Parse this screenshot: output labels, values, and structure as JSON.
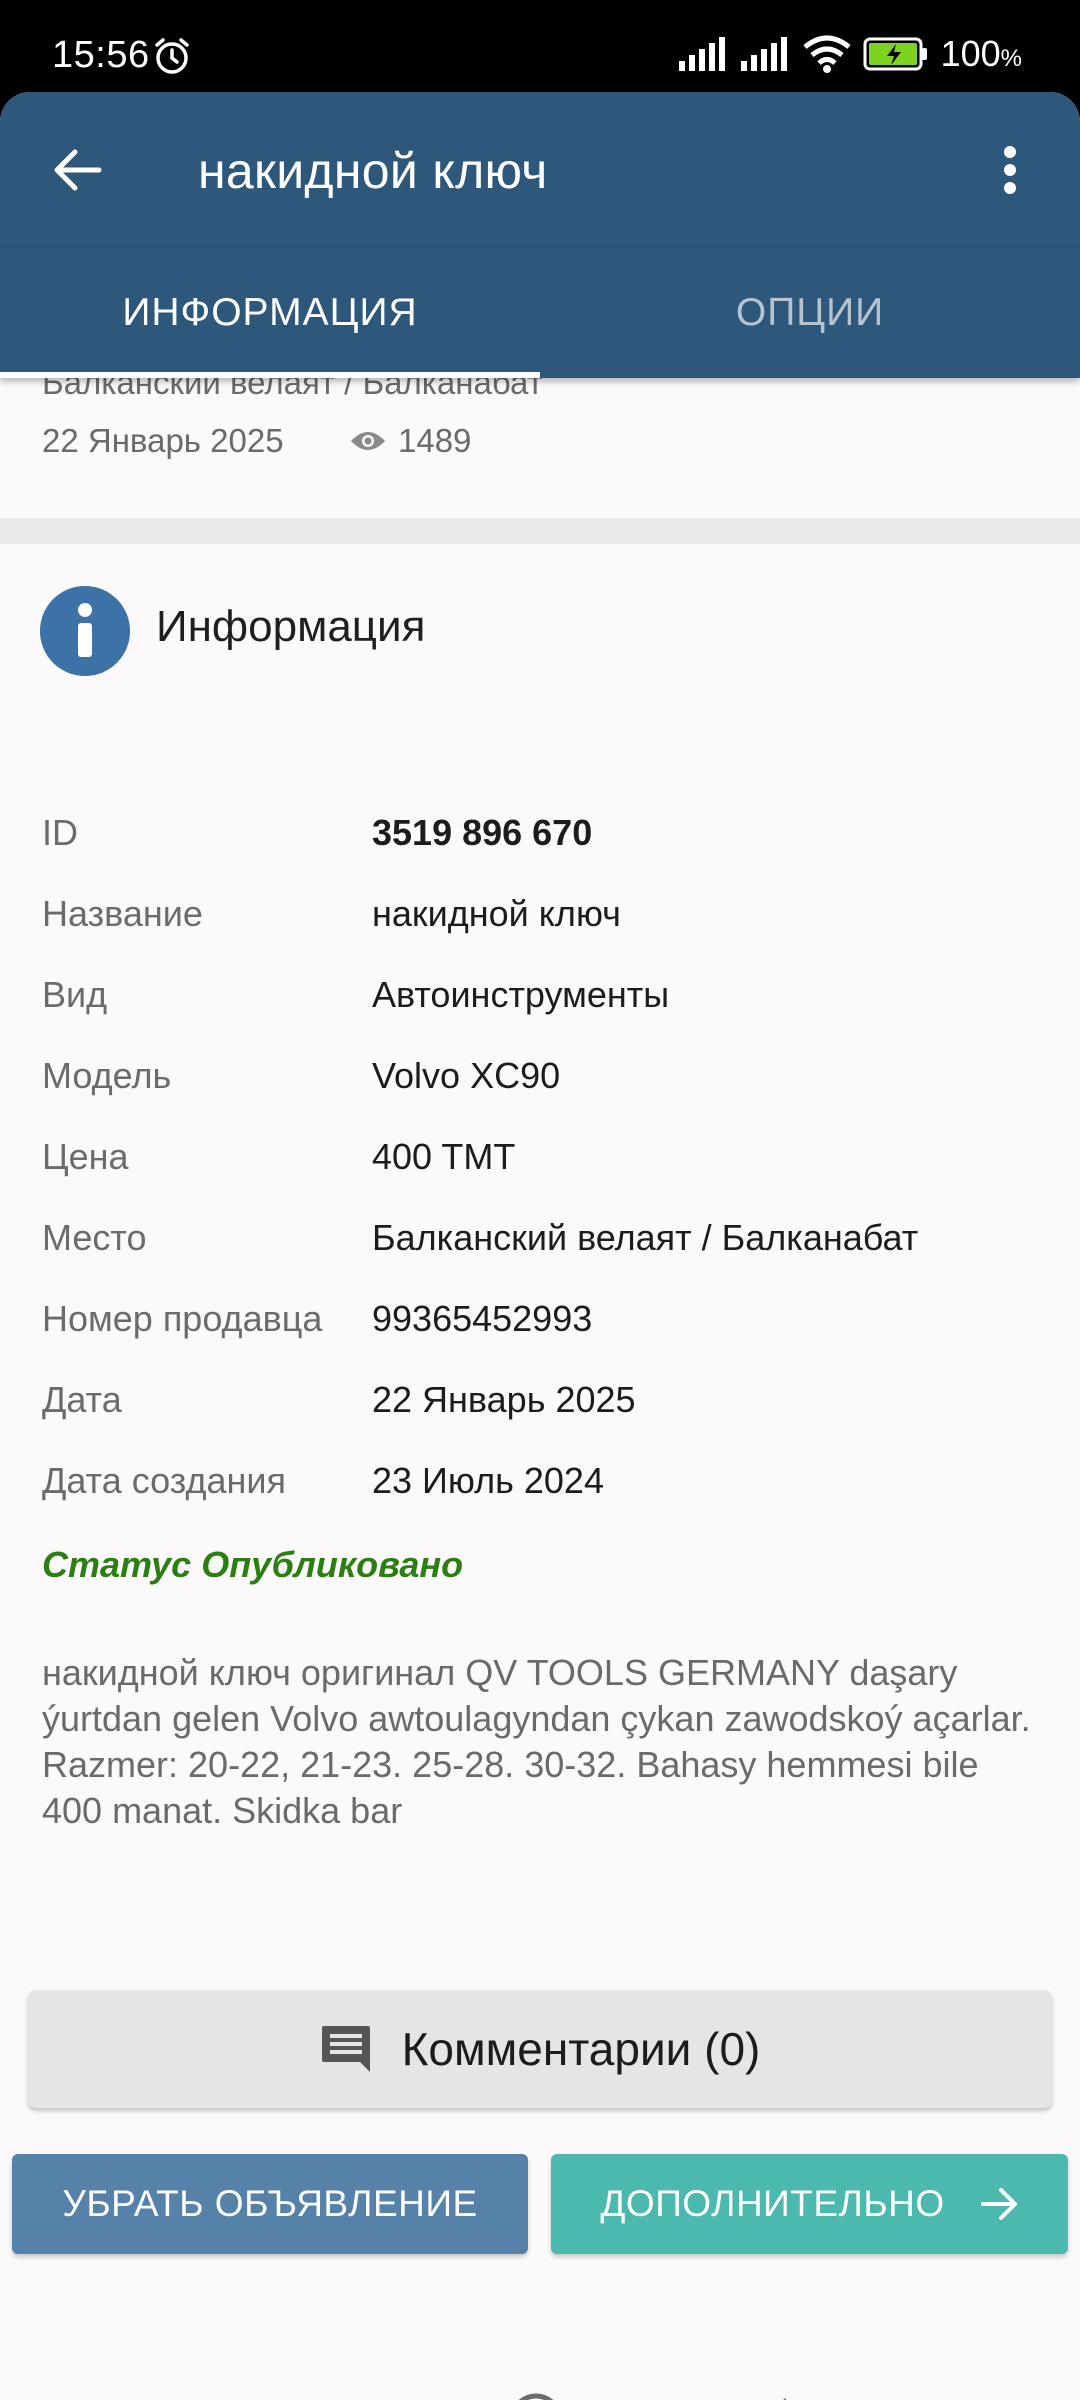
{
  "status_bar": {
    "time": "15:56",
    "battery": "100",
    "battery_unit": "%"
  },
  "app_bar": {
    "title": "накидной ключ"
  },
  "tabs": [
    {
      "label": "ИНФОРМАЦИЯ",
      "selected": true
    },
    {
      "label": "ОПЦИИ",
      "selected": false
    }
  ],
  "listing_header": {
    "location_partial": "Балканский велаят / Балканабат",
    "date": "22 Январь 2025",
    "views": "1489"
  },
  "info_section": {
    "title": "Информация",
    "rows": [
      {
        "label": "ID",
        "value": "3519 896 670"
      },
      {
        "label": "Название",
        "value": "накидной ключ"
      },
      {
        "label": "Вид",
        "value": "Автоинструменты"
      },
      {
        "label": "Модель",
        "value": "Volvo XC90"
      },
      {
        "label": "Цена",
        "value": "400 TMT"
      },
      {
        "label": "Место",
        "value": "Балканский велаят / Балканабат"
      },
      {
        "label": "Номер продавца",
        "value": "99365452993"
      },
      {
        "label": "Дата",
        "value": "22 Январь 2025"
      },
      {
        "label": "Дата создания",
        "value": "23 Июль 2024"
      }
    ],
    "status": "Статус Опубликовано"
  },
  "description": "накидной ключ оригинал QV TOOLS GERMANY daşary ýurtdan gelen Volvo awtoulagyndan çykan zawodskoý açarlar. Razmer: 20-22, 21-23. 25-28. 30-32. Bahasy hemmesi bile 400 manat. Skidka bar",
  "comments_button": {
    "label": "Комментарии (0)"
  },
  "actions": {
    "remove_label": "УБРАТЬ ОБЪЯВЛЕНИЕ",
    "more_label": "ДОПОЛНИТЕЛЬНО"
  },
  "colors": {
    "app_bar": "#2d587c",
    "status_green": "#2b7e12",
    "remove_button": "#5682a9",
    "more_button": "#4bb9ad"
  },
  "icons": [
    "alarm-icon",
    "signal-icon",
    "wifi-icon",
    "battery-icon",
    "back-arrow-icon",
    "more-vert-icon",
    "eye-icon",
    "info-icon",
    "comment-icon",
    "arrow-right-icon",
    "nav-recent-icon",
    "nav-home-icon",
    "nav-back-icon"
  ]
}
